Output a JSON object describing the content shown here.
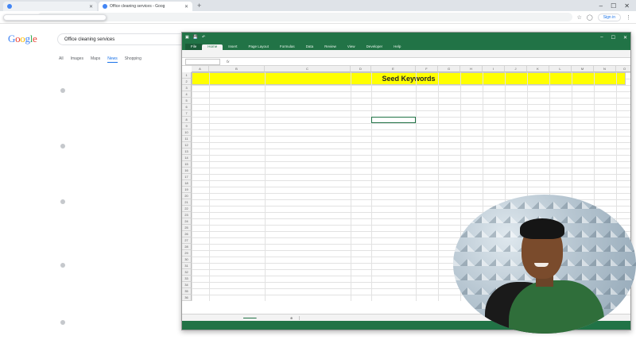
{
  "browser": {
    "tabs": [
      {
        "label": "",
        "active": false
      },
      {
        "label": "Office cleaning services - Goog",
        "active": true
      }
    ],
    "url": "",
    "signin_label": "Sign in",
    "suggestion_lines": [
      "",
      ""
    ]
  },
  "google": {
    "logo": [
      "G",
      "o",
      "o",
      "g",
      "l",
      "e"
    ],
    "query": "Office cleaning services",
    "tabs": [
      "All",
      "Images",
      "Maps",
      "News",
      "Shopping"
    ],
    "active_tab": "News",
    "stats": "",
    "results": [
      {
        "source": "",
        "title": "",
        "snippet": "",
        "age": ""
      },
      {
        "source": "",
        "title": "",
        "snippet": "",
        "age": ""
      },
      {
        "source": "",
        "title": "",
        "snippet": "",
        "age": ""
      },
      {
        "source": "",
        "title": "",
        "snippet": "",
        "age": ""
      },
      {
        "source": "",
        "title": "",
        "snippet": "",
        "age": ""
      }
    ]
  },
  "excel": {
    "file_name": "",
    "ribbon_tabs": [
      "File",
      "Home",
      "Insert",
      "Page Layout",
      "Formulas",
      "Data",
      "Review",
      "View",
      "Developer",
      "Help"
    ],
    "active_ribbon_tab": "Home",
    "name_box": "",
    "formula": "",
    "column_letters": [
      "A",
      "B",
      "C",
      "D",
      "E",
      "F",
      "G",
      "H",
      "I",
      "J",
      "K",
      "L",
      "M",
      "N",
      "O"
    ],
    "row_numbers": [
      "1",
      "2",
      "3",
      "4",
      "5",
      "6",
      "7",
      "8",
      "9",
      "10",
      "11",
      "12",
      "13",
      "14",
      "15",
      "16",
      "17",
      "18",
      "19",
      "20",
      "21",
      "22",
      "23",
      "24",
      "25",
      "26",
      "27",
      "28",
      "29",
      "30",
      "31",
      "32",
      "33",
      "34",
      "35",
      "36"
    ],
    "banner_title": "Seed Keywords",
    "header_row": [
      "",
      "",
      "",
      "",
      "",
      "",
      "",
      "",
      "",
      "",
      "",
      "",
      "",
      "",
      ""
    ],
    "col_b": [
      "",
      "",
      "",
      "",
      "",
      "",
      "",
      "",
      "",
      "",
      "",
      "",
      "",
      "",
      "",
      "",
      "",
      "",
      "",
      "",
      ""
    ],
    "col_c": [
      "",
      "",
      "",
      "",
      "",
      "",
      "",
      "",
      "",
      "",
      "",
      "",
      "",
      "",
      "",
      "",
      "",
      "",
      "",
      "",
      "",
      "",
      "",
      "",
      "",
      "",
      ""
    ],
    "col_e": [
      "",
      "",
      "",
      ""
    ],
    "sheet_tabs": [
      "",
      "",
      "",
      ""
    ],
    "active_sheet_index": 1,
    "status": "",
    "zoom": ""
  },
  "webcam": {
    "icon": "webcam-presenter"
  }
}
